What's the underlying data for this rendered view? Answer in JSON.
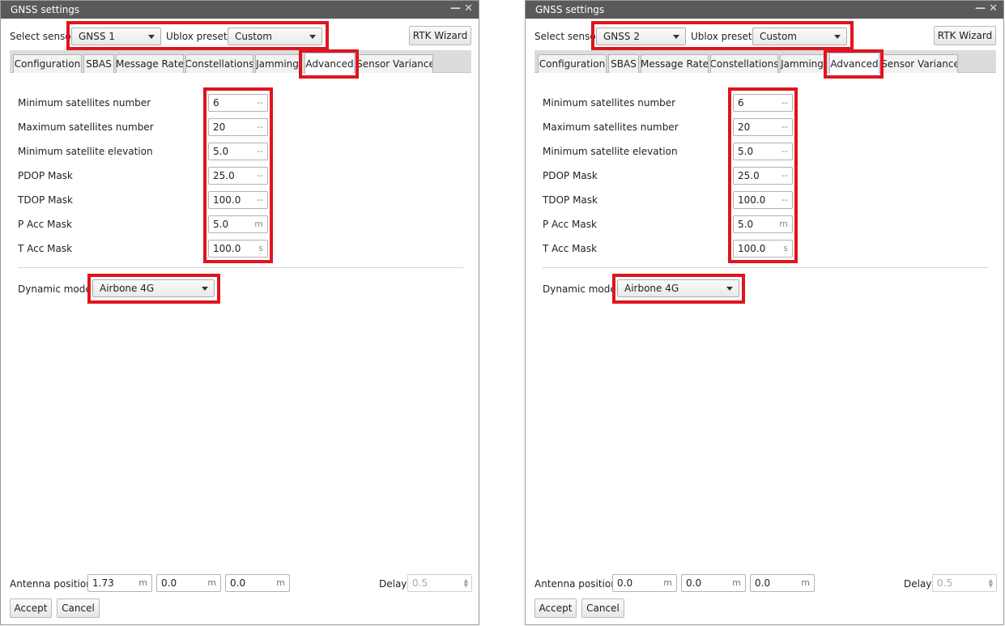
{
  "left": {
    "title": "GNSS settings",
    "select_sensor_label": "Select sensor",
    "sensor_value": "GNSS 1",
    "ublox_label": "Ublox preset:",
    "ublox_value": "Custom",
    "rtk_button": "RTK Wizard",
    "tabs": [
      "Configuration",
      "SBAS",
      "Message Rate",
      "Constellations",
      "Jamming",
      "Advanced",
      "Sensor Variance"
    ],
    "active_tab": "Advanced",
    "rows": [
      {
        "label": "Minimum satellites number",
        "value": "6",
        "unit": "--"
      },
      {
        "label": "Maximum satellites number",
        "value": "20",
        "unit": "--"
      },
      {
        "label": "Minimum satellite elevation",
        "value": "5.0",
        "unit": "--"
      },
      {
        "label": "PDOP Mask",
        "value": "25.0",
        "unit": "--"
      },
      {
        "label": "TDOP Mask",
        "value": "100.0",
        "unit": "--"
      },
      {
        "label": "P Acc Mask",
        "value": "5.0",
        "unit": "m"
      },
      {
        "label": "T Acc Mask",
        "value": "100.0",
        "unit": "s"
      }
    ],
    "dynamic_model_label": "Dynamic model",
    "dynamic_model_value": "Airbone 4G",
    "antenna_label": "Antenna position",
    "antenna": [
      {
        "value": "1.73",
        "unit": "m"
      },
      {
        "value": "0.0",
        "unit": "m"
      },
      {
        "value": "0.0",
        "unit": "m"
      }
    ],
    "delay_label": "Delay",
    "delay_value": "0.5",
    "accept": "Accept",
    "cancel": "Cancel"
  },
  "right": {
    "title": "GNSS settings",
    "select_sensor_label": "Select sensor",
    "sensor_value": "GNSS 2",
    "ublox_label": "Ublox preset:",
    "ublox_value": "Custom",
    "rtk_button": "RTK Wizard",
    "tabs": [
      "Configuration",
      "SBAS",
      "Message Rate",
      "Constellations",
      "Jamming",
      "Advanced",
      "Sensor Variance"
    ],
    "active_tab": "Advanced",
    "rows": [
      {
        "label": "Minimum satellites number",
        "value": "6",
        "unit": "--"
      },
      {
        "label": "Maximum satellites number",
        "value": "20",
        "unit": "--"
      },
      {
        "label": "Minimum satellite elevation",
        "value": "5.0",
        "unit": "--"
      },
      {
        "label": "PDOP Mask",
        "value": "25.0",
        "unit": "--"
      },
      {
        "label": "TDOP Mask",
        "value": "100.0",
        "unit": "--"
      },
      {
        "label": "P Acc Mask",
        "value": "5.0",
        "unit": "m"
      },
      {
        "label": "T Acc Mask",
        "value": "100.0",
        "unit": "s"
      }
    ],
    "dynamic_model_label": "Dynamic model",
    "dynamic_model_value": "Airbone 4G",
    "antenna_label": "Antenna position",
    "antenna": [
      {
        "value": "0.0",
        "unit": "m"
      },
      {
        "value": "0.0",
        "unit": "m"
      },
      {
        "value": "0.0",
        "unit": "m"
      }
    ],
    "delay_label": "Delay",
    "delay_value": "0.5",
    "accept": "Accept",
    "cancel": "Cancel"
  },
  "colors": {
    "highlight": "#e0141e",
    "titlebar": "#5a5a5a"
  },
  "icons": {
    "minimize": "minimize-icon",
    "close": "close-icon",
    "dropdown": "chevron-down-icon"
  }
}
